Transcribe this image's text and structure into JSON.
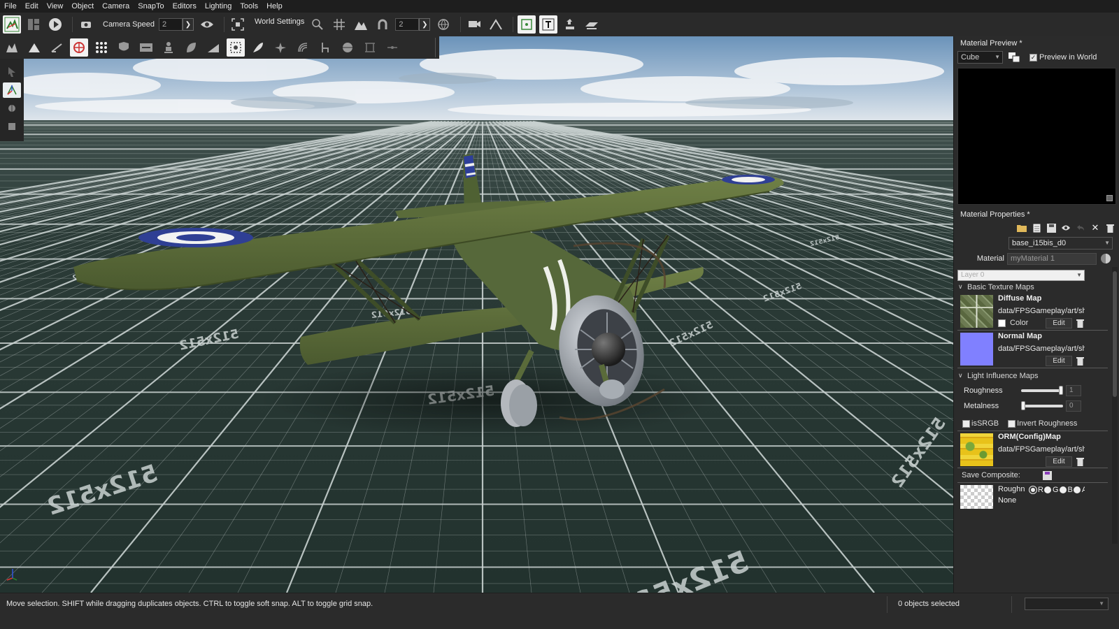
{
  "menu": [
    "File",
    "Edit",
    "View",
    "Object",
    "Camera",
    "SnapTo",
    "Editors",
    "Lighting",
    "Tools",
    "Help"
  ],
  "toolbar": {
    "camera_speed_label": "Camera Speed",
    "camera_speed_value": "2",
    "world_settings_label": "World Settings",
    "grid_value": "2"
  },
  "viewport": {
    "grid_label": "512x512",
    "sky_top": "#6f97bd",
    "grid_color": "#c9d1d0",
    "ground_color": "#253531"
  },
  "material_preview": {
    "title": "Material Preview *",
    "shape": "Cube",
    "preview_in_world_label": "Preview in World",
    "preview_in_world_checked": true
  },
  "material_properties": {
    "title": "Material Properties *",
    "base_material": "base_i15bis_d0",
    "material_label": "Material",
    "material_name": "myMaterial 1",
    "layer": "Layer 0",
    "basic_texture_maps": {
      "title": "Basic Texture Maps",
      "diffuse": {
        "title": "Diffuse Map",
        "path": "data/FPSGameplay/art/sh",
        "color_label": "Color",
        "edit_label": "Edit"
      },
      "normal": {
        "title": "Normal Map",
        "path": "data/FPSGameplay/art/sh",
        "edit_label": "Edit",
        "thumb_color": "#8080ff"
      }
    },
    "light_influence_maps": {
      "title": "Light Influence Maps",
      "roughness_label": "Roughness",
      "roughness_value": "1",
      "roughness_fraction": 1,
      "metalness_label": "Metalness",
      "metalness_value": "0",
      "metalness_fraction": 0,
      "is_srgb_label": "isSRGB",
      "invert_roughness_label": "Invert Roughness",
      "orm": {
        "title": "ORM(Config)Map",
        "path": "data/FPSGameplay/art/sh",
        "edit_label": "Edit"
      },
      "save_composite_label": "Save Composite:",
      "roughness_channel_label": "Roughn",
      "roughness_channel_value": "None",
      "channels": [
        "R",
        "G",
        "B",
        "A"
      ]
    }
  },
  "status": {
    "message": "Move selection.  SHIFT while dragging duplicates objects.  CTRL to toggle soft snap.  ALT to toggle grid snap.",
    "selection_count": "0 objects selected"
  }
}
